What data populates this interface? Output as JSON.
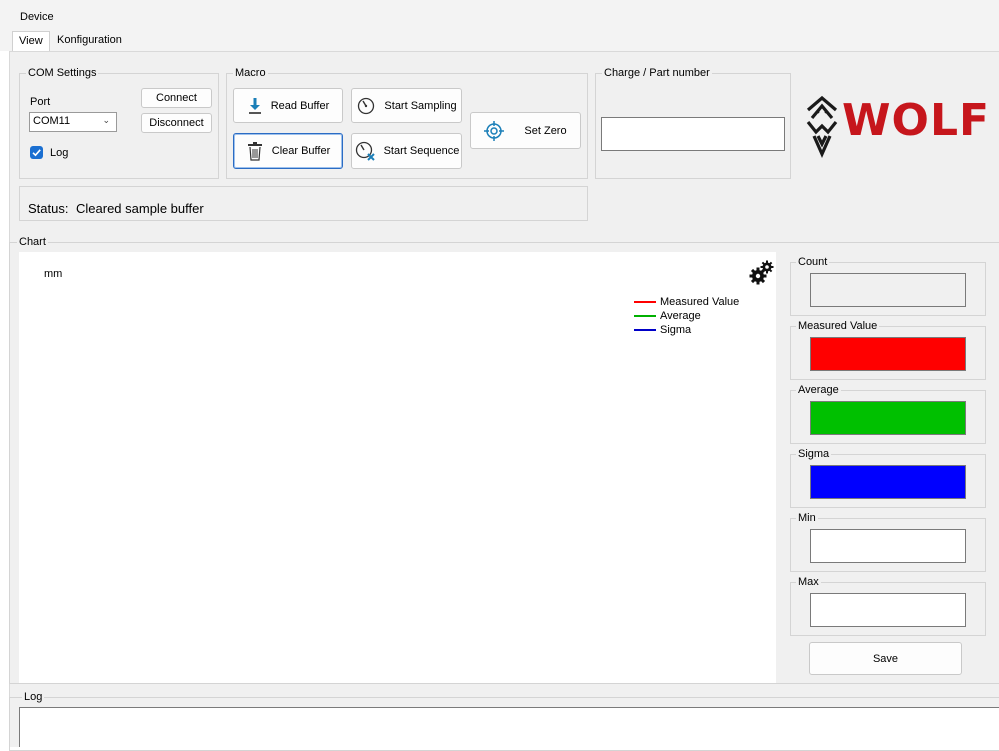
{
  "menu": {
    "device": "Device"
  },
  "tabs": [
    {
      "label": "View"
    },
    {
      "label": "Konfiguration"
    }
  ],
  "com_settings": {
    "legend": "COM Settings",
    "port_label": "Port",
    "port_value": "COM11",
    "connect_label": "Connect",
    "disconnect_label": "Disconnect",
    "log_label": "Log",
    "log_checked": true
  },
  "macro": {
    "legend": "Macro",
    "read_buffer": "Read Buffer",
    "clear_buffer": "Clear Buffer",
    "start_sampling": "Start Sampling",
    "start_sequence": "Start Sequence",
    "set_zero": "Set Zero"
  },
  "charge": {
    "legend": "Charge / Part number",
    "value": ""
  },
  "logo": {
    "text": "WOLF"
  },
  "status": {
    "label": "Status:",
    "text": "Cleared sample buffer"
  },
  "chart": {
    "legend": "Chart",
    "unit": "mm",
    "series_legend": [
      {
        "name": "Measured Value",
        "color": "#ff0000"
      },
      {
        "name": "Average",
        "color": "#00b000"
      },
      {
        "name": "Sigma",
        "color": "#0000c8"
      }
    ]
  },
  "stats": {
    "count": {
      "label": "Count",
      "value": "",
      "color": "#f0f0f0"
    },
    "measured": {
      "label": "Measured Value",
      "value": "",
      "color": "#ff0000"
    },
    "average": {
      "label": "Average",
      "value": "",
      "color": "#00c000"
    },
    "sigma": {
      "label": "Sigma",
      "value": "",
      "color": "#0000ff"
    },
    "min": {
      "label": "Min",
      "value": "",
      "color": "#ffffff"
    },
    "max": {
      "label": "Max",
      "value": "",
      "color": "#ffffff"
    },
    "save_label": "Save"
  },
  "log": {
    "legend": "Log",
    "text": ""
  }
}
